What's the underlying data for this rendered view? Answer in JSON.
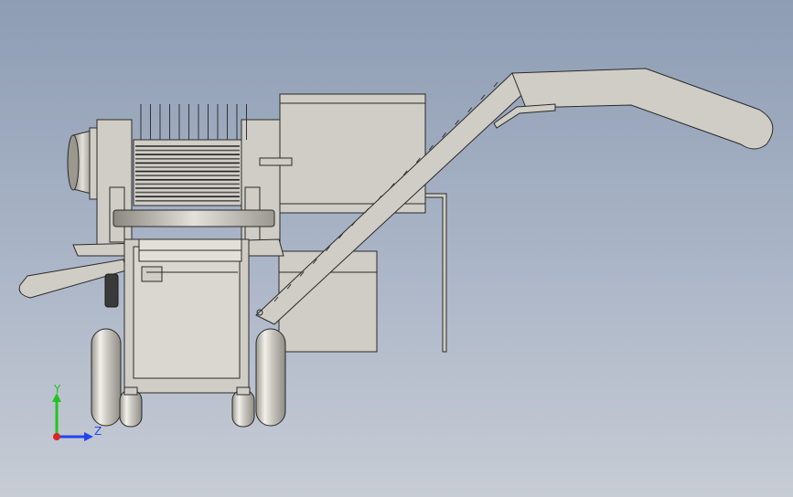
{
  "viewport": {
    "background_top": "#8e9db4",
    "background_bottom": "#c7ccd5",
    "model_fill": "#cfcdc5",
    "model_stroke": "#2a2a2a",
    "dark_part": "#3a3a3a"
  },
  "triad": {
    "x_label": "",
    "y_label": "Y",
    "z_label": "Z",
    "y_color": "#22c422",
    "z_color": "#2244ee",
    "x_color": "#dd2222"
  }
}
